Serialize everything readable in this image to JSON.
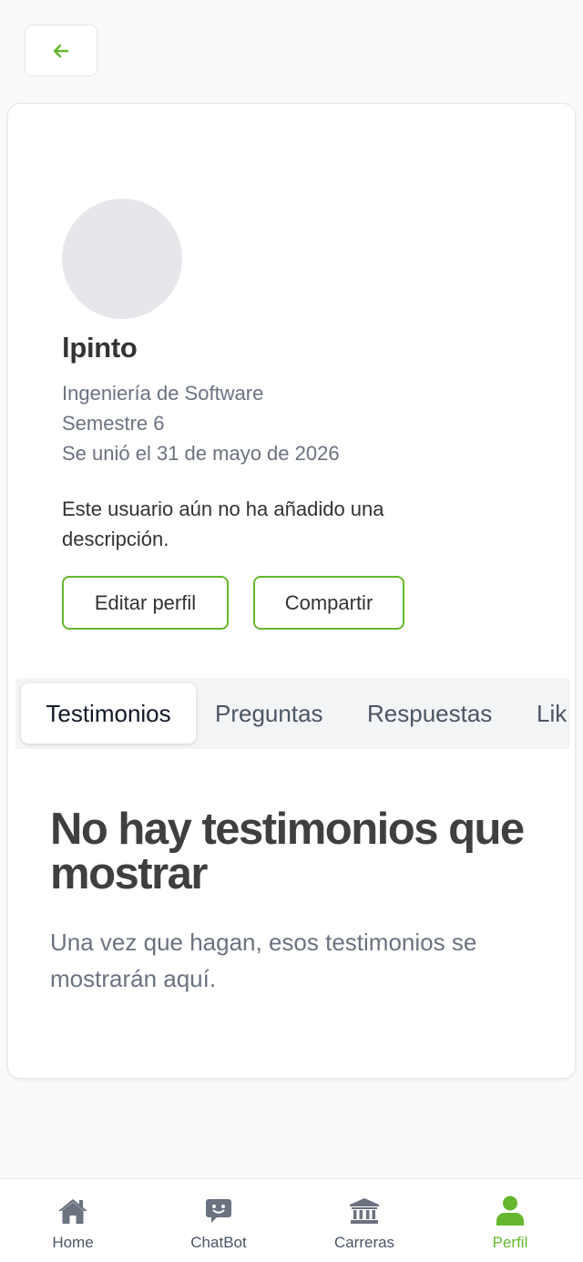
{
  "profile": {
    "username": "lpinto",
    "career": "Ingeniería de Software",
    "semester": "Semestre 6",
    "joined": "Se unió el 31 de mayo de 2026",
    "bio": "Este usuario aún no ha añadido una descripción."
  },
  "actions": {
    "edit_label": "Editar perfil",
    "share_label": "Compartir"
  },
  "tabs": [
    {
      "label": "Testimonios",
      "active": true
    },
    {
      "label": "Preguntas",
      "active": false
    },
    {
      "label": "Respuestas",
      "active": false
    },
    {
      "label": "Lik",
      "active": false
    }
  ],
  "empty_state": {
    "title": "No hay testimonios que mostrar",
    "description": "Una vez que hagan, esos testimonios se mostrarán aquí."
  },
  "nav": [
    {
      "label": "Home",
      "icon": "home-icon",
      "active": false
    },
    {
      "label": "ChatBot",
      "icon": "chatbot-icon",
      "active": false
    },
    {
      "label": "Carreras",
      "icon": "university-icon",
      "active": false
    },
    {
      "label": "Perfil",
      "icon": "user-icon",
      "active": true
    }
  ],
  "colors": {
    "accent": "#65b72e",
    "icon_gray": "#6b7280",
    "avatar_bg": "#e5e7eb"
  }
}
